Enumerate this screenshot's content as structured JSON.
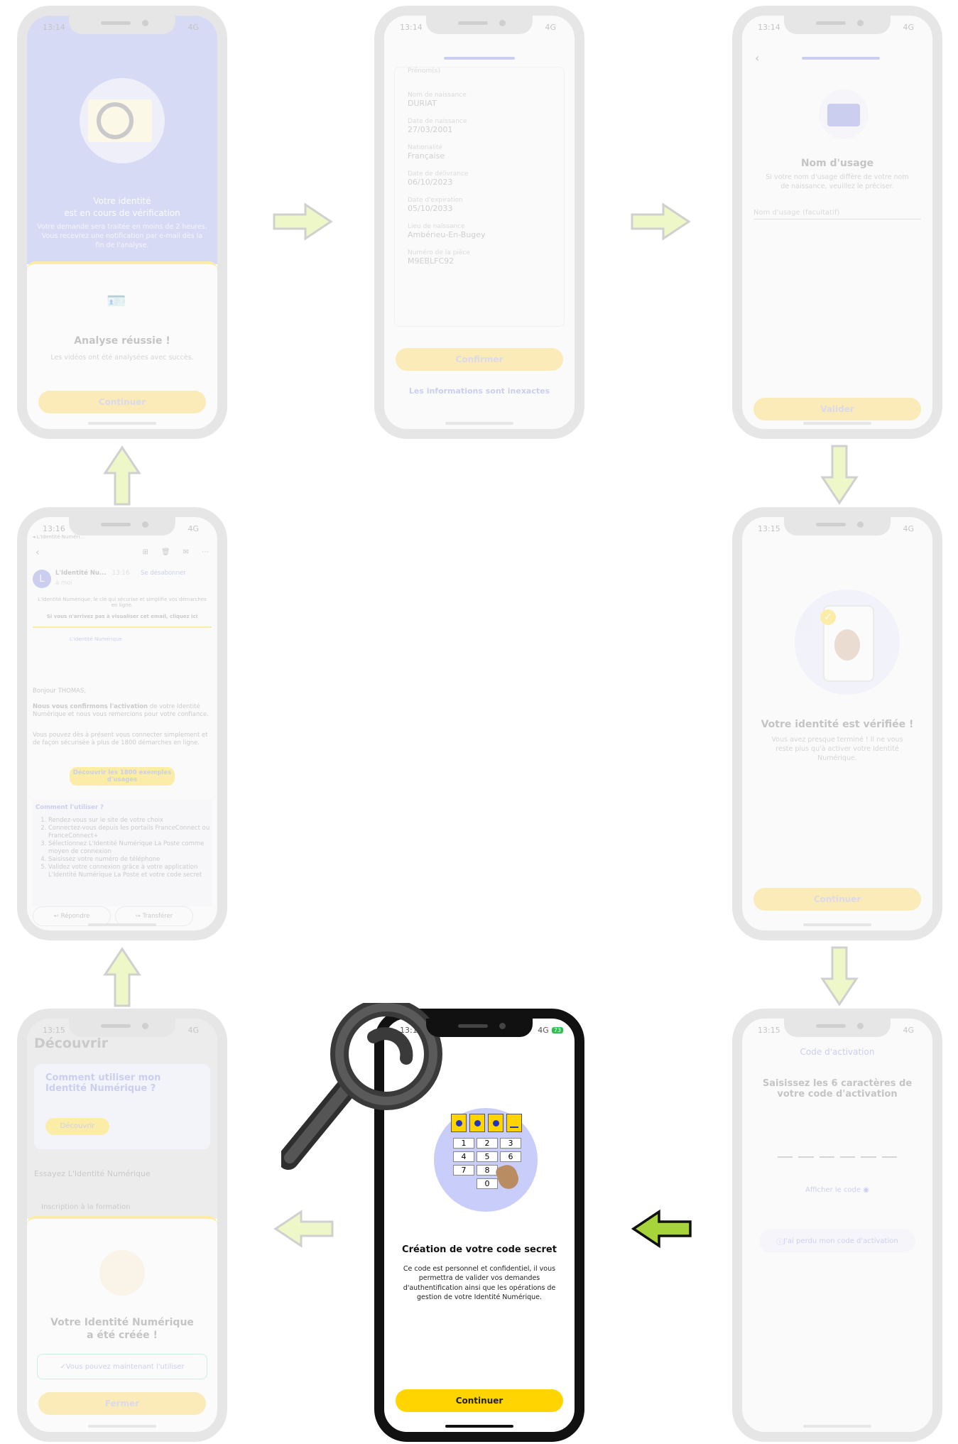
{
  "colors": {
    "accent_yellow": "#ffd400",
    "lavender": "#c9cdfa",
    "arrow_green_light": "#eef7c8",
    "arrow_green": "#a6d43a"
  },
  "screen1": {
    "time": "13:14",
    "network": "4G",
    "battery": "",
    "title_line1": "Votre identité",
    "title_line2": "est en cours de vérification",
    "subtitle": "Votre demande sera traitée en moins de 2 heures. Vous recevrez une notification par e-mail dès la fin de l'analyse.",
    "sheet_title": "Analyse réussie !",
    "sheet_text": "Les vidéos ont été analysées avec succès.",
    "button": "Continuer"
  },
  "screen2": {
    "time": "13:14",
    "network": "4G",
    "battery": "",
    "top_label": "Prénom(s)",
    "fields": [
      {
        "label": "Nom de naissance",
        "value": "DURIAT"
      },
      {
        "label": "Date de naissance",
        "value": "27/03/2001"
      },
      {
        "label": "Nationalité",
        "value": "Française"
      },
      {
        "label": "Date de délivrance",
        "value": "06/10/2023"
      },
      {
        "label": "Date d'expiration",
        "value": "05/10/2033"
      },
      {
        "label": "Lieu de naissance",
        "value": "Ambérieu-En-Bugey"
      },
      {
        "label": "Numéro de la pièce",
        "value": "M9EBLFC92"
      }
    ],
    "button": "Confirmer",
    "link": "Les informations sont inexactes"
  },
  "screen3": {
    "time": "13:14",
    "network": "4G",
    "battery": "",
    "title": "Nom d'usage",
    "text": "Si votre nom d'usage diffère de votre nom de naissance, veuillez le préciser.",
    "input_placeholder": "Nom d'usage (facultatif)",
    "button": "Valider"
  },
  "screen4": {
    "time": "13:16",
    "network": "4G",
    "battery": "",
    "back_app": "◂ L'Identité Numéri...",
    "sender": "L'Identité Nu...",
    "sender_time": "13:16",
    "unsubscribe": "Se désabonner",
    "to": "à moi",
    "intro": "L'Identité Numérique, le clé qui sécurise et simplifie vos démarches en ligne.",
    "view_notice": "Si vous n'arrivez pas à visualiser cet email, cliquez ici",
    "logo_text": "L'Identité Numérique",
    "greeting": "Bonjour THOMAS,",
    "p1_bold": "Nous vous confirmons l'activation",
    "p1": "de votre Identité Numérique et nous vous remercions pour votre confiance.",
    "p2": "Vous pouvez dès à présent vous connecter simplement et de façon sécurisée à plus de 1800 démarches en ligne.",
    "cta": "Découvrir les 1800 exemples d'usages",
    "howto_title": "Comment l'utiliser ?",
    "steps": [
      "Rendez-vous sur le site de votre choix",
      "Connectez-vous depuis les portails FranceConnect ou FranceConnect+",
      "Sélectionnez L'Identité Numérique La Poste comme moyen de connexion",
      "Saisissez votre numéro de téléphone",
      "Validez votre connexion grâce à votre application L'Identité Numérique La Poste et votre code secret"
    ],
    "reply": "Répondre",
    "forward": "Transférer"
  },
  "screen5": {
    "time": "13:15",
    "network": "4G",
    "battery": "",
    "title": "Votre identité est vérifiée !",
    "text": "Vous avez presque terminé ! Il ne vous reste plus qu'à activer votre Identité Numérique.",
    "button": "Continuer"
  },
  "screen6": {
    "time": "13:15",
    "network": "4G",
    "battery": "",
    "header": "Découvrir",
    "card_title": "Comment utiliser mon Identité Numérique ?",
    "card_button": "Découvrir",
    "section": "Essayez L'Identité Numérique",
    "row": "Inscription à la formation",
    "sheet_title_line1": "Votre Identité Numérique",
    "sheet_title_line2": "a été créée !",
    "info": "Vous pouvez maintenant l'utiliser",
    "button": "Fermer"
  },
  "screen7": {
    "time": "13:15",
    "network": "4G",
    "battery": "73",
    "keys": [
      "1",
      "2",
      "3",
      "4",
      "5",
      "6",
      "7",
      "8",
      "0"
    ],
    "title": "Création de votre code secret",
    "text": "Ce code est personnel et confidentiel, il vous permettra de valider vos demandes d'authentification ainsi que les opérations de gestion de votre Identité Numérique.",
    "button": "Continuer"
  },
  "screen8": {
    "time": "13:15",
    "network": "4G",
    "battery": "",
    "header": "Code d'activation",
    "title": "Saisissez les 6 caractères de votre code d'activation",
    "show_code": "Afficher le code",
    "lost_code": "J'ai perdu mon code d'activation"
  }
}
